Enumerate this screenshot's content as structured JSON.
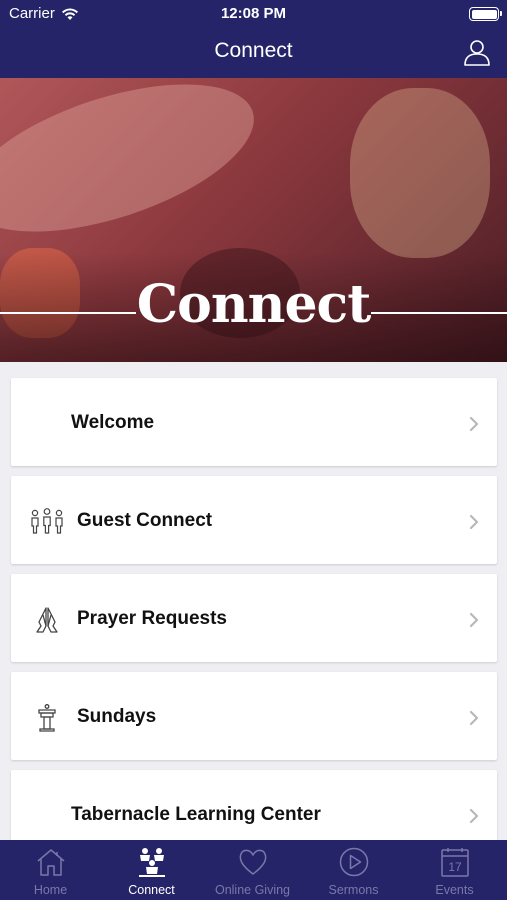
{
  "status": {
    "carrier": "Carrier",
    "time": "12:08 PM"
  },
  "nav": {
    "title": "Connect"
  },
  "hero": {
    "title": "Connect"
  },
  "items": [
    {
      "label": "Welcome",
      "icon": ""
    },
    {
      "label": "Guest Connect",
      "icon": "people-group-icon"
    },
    {
      "label": "Prayer Requests",
      "icon": "praying-hands-icon"
    },
    {
      "label": "Sundays",
      "icon": "pulpit-icon"
    },
    {
      "label": "Tabernacle Learning Center",
      "icon": ""
    }
  ],
  "tabs": [
    {
      "label": "Home",
      "icon": "home-icon",
      "active": false
    },
    {
      "label": "Connect",
      "icon": "people-icon",
      "active": true
    },
    {
      "label": "Online Giving",
      "icon": "heart-icon",
      "active": false
    },
    {
      "label": "Sermons",
      "icon": "play-circle-icon",
      "active": false
    },
    {
      "label": "Events",
      "icon": "calendar-icon",
      "calendar_day": "17",
      "active": false
    }
  ],
  "colors": {
    "brand": "#262468",
    "tab_inactive": "#7a78a8",
    "card_bg": "#ffffff",
    "page_bg": "#efeff3"
  }
}
